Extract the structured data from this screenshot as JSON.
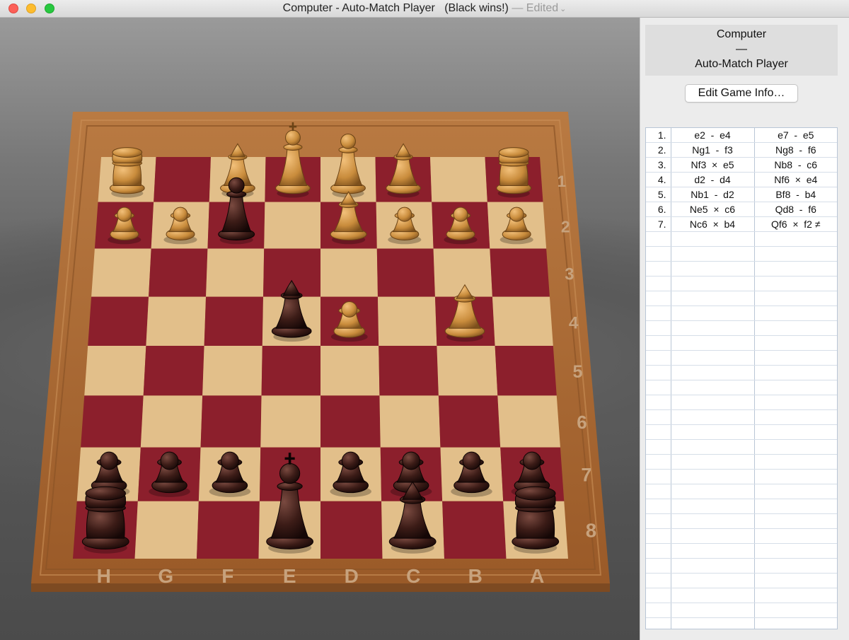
{
  "window": {
    "title_main": "Computer - Auto-Match Player",
    "title_status": "(Black wins!)",
    "title_edited": "— Edited",
    "chevron": "⌄"
  },
  "board": {
    "ranks": [
      "1",
      "2",
      "3",
      "4",
      "5",
      "6",
      "7",
      "8"
    ],
    "files": [
      "H",
      "G",
      "F",
      "E",
      "D",
      "C",
      "B",
      "A"
    ],
    "colors": {
      "light": "#e2bf8a",
      "dark": "#8c1f2c",
      "frame": "#a8652f",
      "white_piece": "#d49a4a",
      "black_piece": "#3a1a16"
    },
    "pieces": [
      {
        "color": "white",
        "type": "rook",
        "square": "h1"
      },
      {
        "color": "white",
        "type": "pawn",
        "square": "h2"
      },
      {
        "color": "white",
        "type": "pawn",
        "square": "g2"
      },
      {
        "color": "white",
        "type": "bishop",
        "square": "f1"
      },
      {
        "color": "white",
        "type": "king",
        "square": "e1"
      },
      {
        "color": "white",
        "type": "queen",
        "square": "d1"
      },
      {
        "color": "white",
        "type": "bishop",
        "square": "c1"
      },
      {
        "color": "white",
        "type": "rook",
        "square": "a1"
      },
      {
        "color": "white",
        "type": "pawn",
        "square": "a2"
      },
      {
        "color": "white",
        "type": "pawn",
        "square": "b2"
      },
      {
        "color": "white",
        "type": "pawn",
        "square": "c2"
      },
      {
        "color": "white",
        "type": "knight",
        "square": "d2"
      },
      {
        "color": "white",
        "type": "pawn",
        "square": "d4"
      },
      {
        "color": "white",
        "type": "knight",
        "square": "b4"
      },
      {
        "color": "black",
        "type": "queen",
        "square": "f2"
      },
      {
        "color": "black",
        "type": "bishop",
        "square": "e4"
      },
      {
        "color": "black",
        "type": "pawn",
        "square": "h7"
      },
      {
        "color": "black",
        "type": "pawn",
        "square": "g7"
      },
      {
        "color": "black",
        "type": "pawn",
        "square": "f7"
      },
      {
        "color": "black",
        "type": "pawn",
        "square": "d7"
      },
      {
        "color": "black",
        "type": "pawn",
        "square": "c7"
      },
      {
        "color": "black",
        "type": "pawn",
        "square": "b7"
      },
      {
        "color": "black",
        "type": "pawn",
        "square": "a7"
      },
      {
        "color": "black",
        "type": "rook",
        "square": "h8"
      },
      {
        "color": "black",
        "type": "king",
        "square": "e8"
      },
      {
        "color": "black",
        "type": "bishop",
        "square": "c8"
      },
      {
        "color": "black",
        "type": "rook",
        "square": "a8"
      }
    ]
  },
  "panel": {
    "player_line1": "Computer",
    "player_line2": "—",
    "player_line3": "Auto-Match Player",
    "edit_button": "Edit Game Info…",
    "moves": [
      {
        "num": "1.",
        "white": "e2  -  e4",
        "black": "e7  -  e5"
      },
      {
        "num": "2.",
        "white": "Ng1  -  f3",
        "black": "Ng8  -  f6"
      },
      {
        "num": "3.",
        "white": "Nf3  ×  e5",
        "black": "Nb8  -  c6"
      },
      {
        "num": "4.",
        "white": "d2  -  d4",
        "black": "Nf6  ×  e4"
      },
      {
        "num": "5.",
        "white": "Nb1  -  d2",
        "black": "Bf8  -  b4"
      },
      {
        "num": "6.",
        "white": "Ne5  ×  c6",
        "black": "Qd8  -  f6"
      },
      {
        "num": "7.",
        "white": "Nc6  ×  b4",
        "black": "Qf6  ×  f2 ≠"
      }
    ]
  }
}
